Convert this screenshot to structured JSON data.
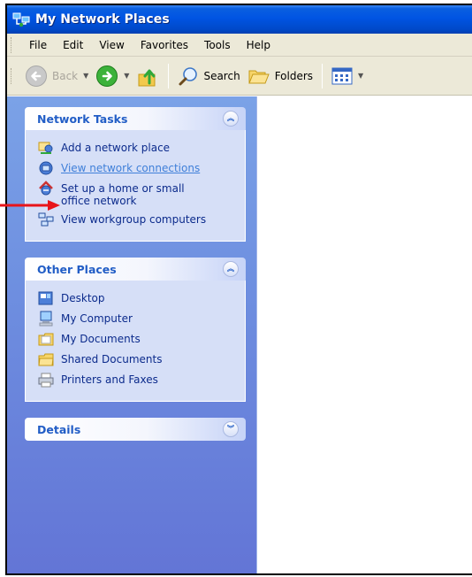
{
  "window": {
    "title": "My Network Places"
  },
  "menubar": {
    "items": [
      "File",
      "Edit",
      "View",
      "Favorites",
      "Tools",
      "Help"
    ]
  },
  "toolbar": {
    "back_label": "Back",
    "search_label": "Search",
    "folders_label": "Folders"
  },
  "panels": {
    "network_tasks": {
      "title": "Network Tasks",
      "items": [
        {
          "label": "Add a network place",
          "icon": "add-network-place-icon"
        },
        {
          "label": "View network connections",
          "icon": "network-connections-icon"
        },
        {
          "label": "Set up a home or small office network",
          "icon": "home-network-setup-icon"
        },
        {
          "label": "View workgroup computers",
          "icon": "workgroup-computers-icon"
        }
      ]
    },
    "other_places": {
      "title": "Other Places",
      "items": [
        {
          "label": "Desktop",
          "icon": "desktop-icon"
        },
        {
          "label": "My Computer",
          "icon": "my-computer-icon"
        },
        {
          "label": "My Documents",
          "icon": "my-documents-icon"
        },
        {
          "label": "Shared Documents",
          "icon": "shared-documents-icon"
        },
        {
          "label": "Printers and Faxes",
          "icon": "printers-faxes-icon"
        }
      ]
    },
    "details": {
      "title": "Details"
    }
  },
  "colors": {
    "titlebar": "#0054e3",
    "taskpane": "#6e8fe0",
    "panel_title": "#215dc6",
    "link": "#0c2b8c",
    "annotation_arrow": "#e8141a"
  }
}
